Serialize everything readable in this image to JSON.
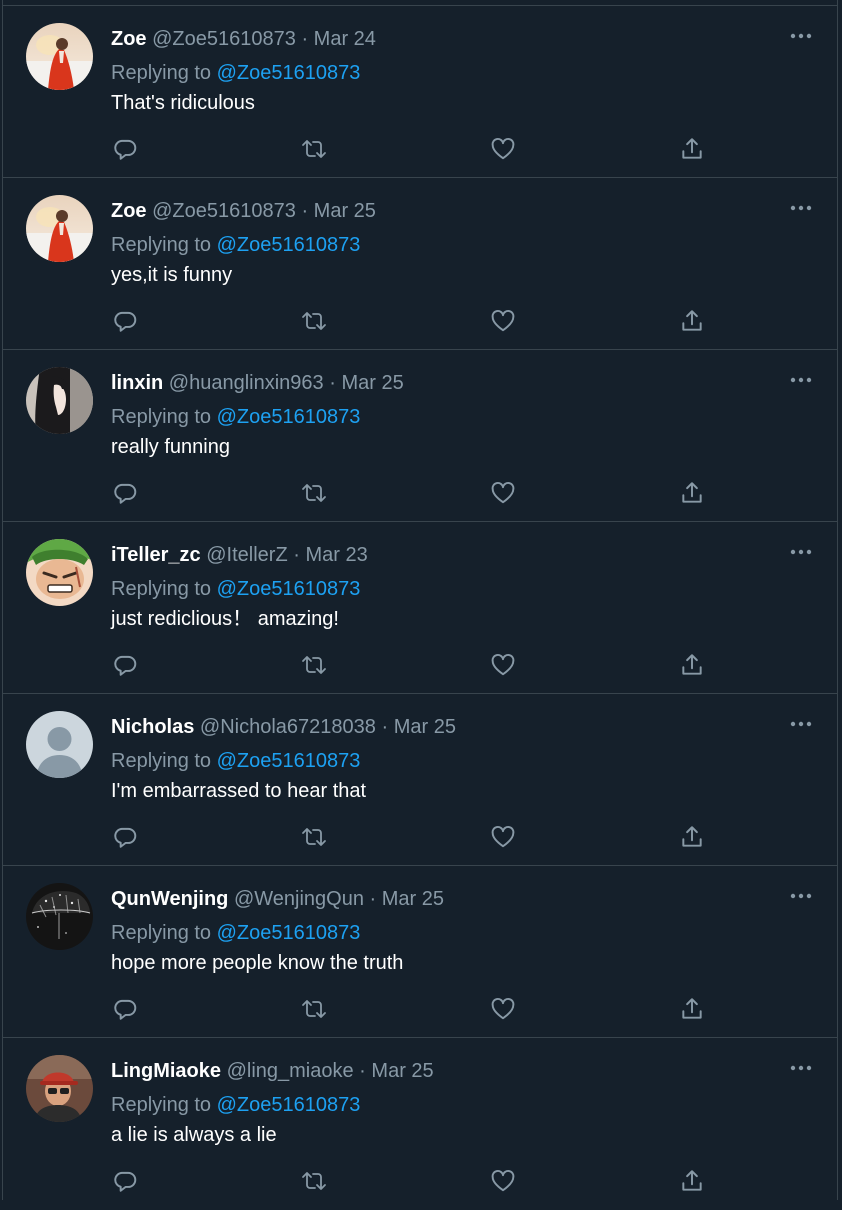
{
  "replies": [
    {
      "name": "Zoe",
      "handle": "@Zoe51610873",
      "date": "Mar 24",
      "replying_prefix": "Replying to",
      "replying_to": "@Zoe51610873",
      "text": "That's ridiculous",
      "avatar": "photo-woman-red-coat"
    },
    {
      "name": "Zoe",
      "handle": "@Zoe51610873",
      "date": "Mar 25",
      "replying_prefix": "Replying to",
      "replying_to": "@Zoe51610873",
      "text": "yes,it is funny",
      "avatar": "photo-woman-red-coat"
    },
    {
      "name": "linxin",
      "handle": "@huanglinxin963",
      "date": "Mar 25",
      "replying_prefix": "Replying to",
      "replying_to": "@Zoe51610873",
      "text": "really funning",
      "avatar": "photo-dark-hair-profile"
    },
    {
      "name": "iTeller_zc",
      "handle": "@ItellerZ",
      "date": "Mar 23",
      "replying_prefix": "Replying to",
      "replying_to": "@Zoe51610873",
      "text": "just rediclious！ amazing!",
      "avatar": "anime-green-hair"
    },
    {
      "name": "Nicholas",
      "handle": "@Nichola67218038",
      "date": "Mar 25",
      "replying_prefix": "Replying to",
      "replying_to": "@Zoe51610873",
      "text": "I'm embarrassed to hear that",
      "avatar": "default-profile"
    },
    {
      "name": "QunWenjing",
      "handle": "@WenjingQun",
      "date": "Mar 25",
      "replying_prefix": "Replying to",
      "replying_to": "@Zoe51610873",
      "text": "hope more people know the truth",
      "avatar": "photo-dark-umbrella"
    },
    {
      "name": "LingMiaoke",
      "handle": "@ling_miaoke",
      "date": "Mar 25",
      "replying_prefix": "Replying to",
      "replying_to": "@Zoe51610873",
      "text": "a lie is always a lie",
      "avatar": "photo-man-cap"
    }
  ],
  "separator": "·",
  "icons": {
    "more": "more-dots-icon",
    "reply": "reply-icon",
    "retweet": "retweet-icon",
    "like": "like-icon",
    "share": "share-icon"
  },
  "colors": {
    "background": "#15202b",
    "border": "#38444d",
    "secondary_text": "#8899a6",
    "link": "#1da1f2"
  }
}
